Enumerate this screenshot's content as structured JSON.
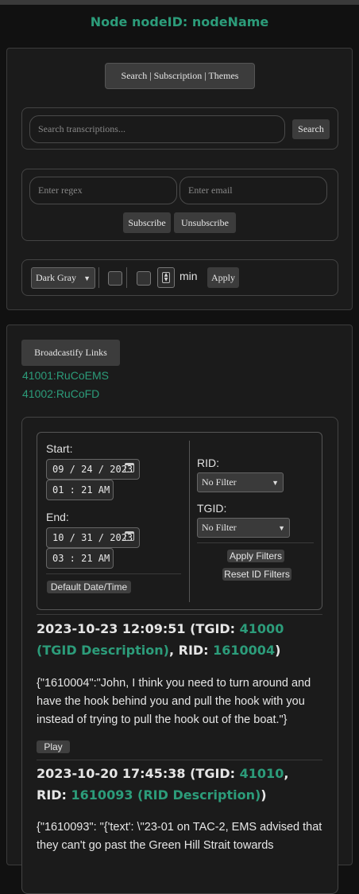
{
  "page": {
    "title": "Node nodeID: nodeName"
  },
  "toolbar": {
    "toggle_label": "Search | Subscription | Themes"
  },
  "search": {
    "placeholder": "Search transcriptions...",
    "button_label": "Search"
  },
  "subscription": {
    "regex_placeholder": "Enter regex",
    "email_placeholder": "Enter email",
    "subscribe_label": "Subscribe",
    "unsubscribe_label": "Unsubscribe"
  },
  "theme": {
    "selected": "Dark Gray",
    "min_unit": "min",
    "apply_label": "Apply"
  },
  "broadcastify": {
    "button_label": "Broadcastify Links",
    "links": [
      "41001:RuCoEMS",
      "41002:RuCoFD"
    ]
  },
  "filters": {
    "start_label": "Start:",
    "start_date": "09 / 24 / 2023",
    "start_time": "01 : 21  AM",
    "end_label": "End:",
    "end_date": "10 / 31 / 2023",
    "end_time": "03 : 21  AM",
    "default_label": "Default Date/Time",
    "rid_label": "RID:",
    "rid_selected": "No Filter",
    "tgid_label": "TGID:",
    "tgid_selected": "No Filter",
    "apply_label": "Apply Filters",
    "reset_label": "Reset ID Filters"
  },
  "calls": [
    {
      "time": "2023-10-23 12:09:51",
      "tgid_prefix": " (TGID: ",
      "tgid": "41000 (TGID Description)",
      "rid_prefix": ", RID: ",
      "rid": "1610004",
      "suffix": ")",
      "text": "{\"1610004\":\"John, I think you need to turn around and have the hook behind you and pull the hook with you instead of trying to pull the hook out of the boat.\"}",
      "play_label": "Play"
    },
    {
      "time": "2023-10-20 17:45:38",
      "tgid_prefix": " (TGID: ",
      "tgid": "41010",
      "rid_prefix": ", RID: ",
      "rid": "1610093 (RID Description)",
      "suffix": ")",
      "text": "{\"1610093\": \"{'text': \\\"23-01 on TAC-2, EMS advised that they can't go past the Green Hill Strait towards",
      "play_label": "Play"
    }
  ],
  "colors": {
    "accent": "#2c9c7a",
    "background": "#111111",
    "panel": "#1b1b1b"
  },
  "icons": {
    "calendar": "calendar-icon",
    "stepper": "stepper-icon",
    "chevron": "chevron-down-icon"
  }
}
